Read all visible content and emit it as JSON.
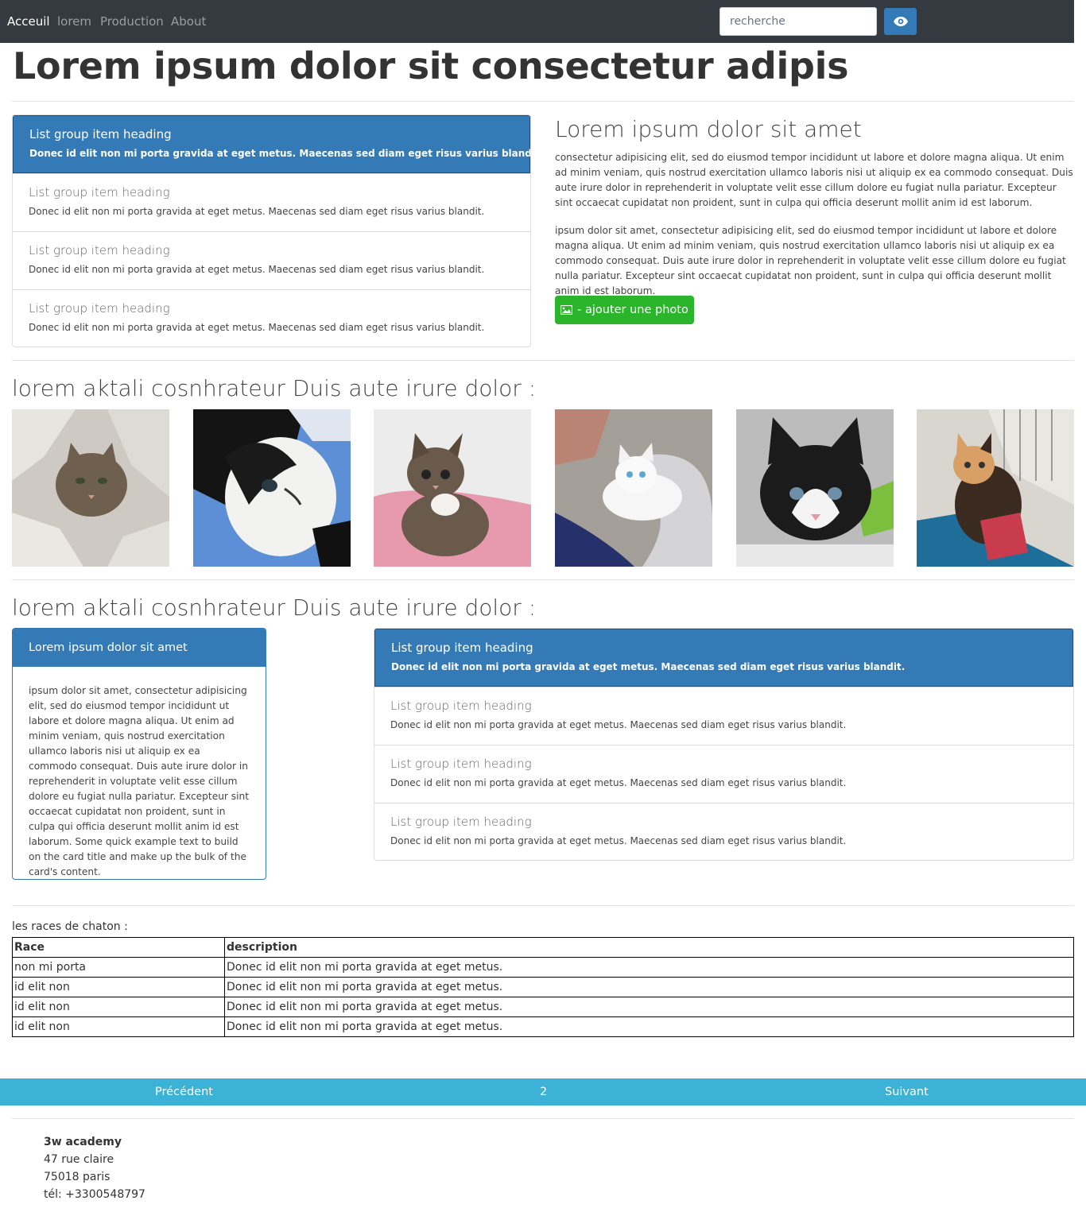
{
  "nav": {
    "links": [
      "Acceuil",
      "lorem",
      "Production",
      "About"
    ],
    "search_placeholder": "recherche",
    "search_button_icon": "eye-icon"
  },
  "main_title": "Lorem ipsum dolor sit consectetur adipis",
  "list_group_1": {
    "items": [
      {
        "heading": "List group item heading",
        "text": "Donec id elit non mi porta gravida at eget metus. Maecenas sed diam eget risus varius blandit.",
        "active": true
      },
      {
        "heading": "List group item heading",
        "text": "Donec id elit non mi porta gravida at eget metus. Maecenas sed diam eget risus varius blandit.",
        "active": false
      },
      {
        "heading": "List group item heading",
        "text": "Donec id elit non mi porta gravida at eget metus. Maecenas sed diam eget risus varius blandit.",
        "active": false
      },
      {
        "heading": "List group item heading",
        "text": "Donec id elit non mi porta gravida at eget metus. Maecenas sed diam eget risus varius blandit.",
        "active": false
      }
    ]
  },
  "intro": {
    "title": "Lorem ipsum dolor sit amet",
    "paragraph_1": "consectetur adipisicing elit, sed do eiusmod tempor incididunt ut labore et dolore magna aliqua. Ut enim ad minim veniam, quis nostrud exercitation ullamco laboris nisi ut aliquip ex ea commodo consequat. Duis aute irure dolor in reprehenderit in voluptate velit esse cillum dolore eu fugiat nulla pariatur. Excepteur sint occaecat cupidatat non proident, sunt in culpa qui officia deserunt mollit anim id est laborum.",
    "paragraph_2": "ipsum dolor sit amet, consectetur adipisicing elit, sed do eiusmod tempor incididunt ut labore et dolore magna aliqua. Ut enim ad minim veniam, quis nostrud exercitation ullamco laboris nisi ut aliquip ex ea commodo consequat. Duis aute irure dolor in reprehenderit in voluptate velit esse cillum dolore eu fugiat nulla pariatur. Excepteur sint occaecat cupidatat non proident, sunt in culpa qui officia deserunt mollit anim id est laborum.",
    "button_label": "- ajouter une photo",
    "button_icon": "image-icon"
  },
  "gallery": {
    "title": "lorem aktali cosnhrateur Duis aute irure dolor :"
  },
  "section_2": {
    "title": "lorem aktali cosnhrateur Duis aute irure dolor :",
    "card": {
      "header": "Lorem ipsum dolor sit amet",
      "body": "ipsum dolor sit amet, consectetur adipisicing elit, sed do eiusmod tempor incididunt ut labore et dolore magna aliqua. Ut enim ad minim veniam, quis nostrud exercitation ullamco laboris nisi ut aliquip ex ea commodo consequat. Duis aute irure dolor in reprehenderit in voluptate velit esse cillum dolore eu fugiat nulla pariatur. Excepteur sint occaecat cupidatat non proident, sunt in culpa qui officia deserunt mollit anim id est laborum. Some quick example text to build on the card title and make up the bulk of the card's content."
    },
    "list_group": {
      "items": [
        {
          "heading": "List group item heading",
          "text": "Donec id elit non mi porta gravida at eget metus. Maecenas sed diam eget risus varius blandit.",
          "active": true
        },
        {
          "heading": "List group item heading",
          "text": "Donec id elit non mi porta gravida at eget metus. Maecenas sed diam eget risus varius blandit.",
          "active": false
        },
        {
          "heading": "List group item heading",
          "text": "Donec id elit non mi porta gravida at eget metus. Maecenas sed diam eget risus varius blandit.",
          "active": false
        },
        {
          "heading": "List group item heading",
          "text": "Donec id elit non mi porta gravida at eget metus. Maecenas sed diam eget risus varius blandit.",
          "active": false
        }
      ]
    }
  },
  "table": {
    "caption": "les races de chaton :",
    "headers": [
      "Race",
      "description"
    ],
    "rows": [
      [
        "non mi porta",
        "Donec id elit non mi porta gravida at eget metus."
      ],
      [
        "id elit non",
        "Donec id elit non mi porta gravida at eget metus."
      ],
      [
        "id elit non",
        "Donec id elit non mi porta gravida at eget metus."
      ],
      [
        "id elit non",
        "Donec id elit non mi porta gravida at eget metus."
      ]
    ]
  },
  "pagination": {
    "prev": "Précédent",
    "page": "2",
    "next": "Suivant"
  },
  "footer": {
    "name": "3w academy",
    "address": "47 rue claire",
    "city": "75018 paris",
    "phone": "tél: +3300548797"
  },
  "colors": {
    "navbar": "#343a40",
    "primary": "#337ab7",
    "success": "#2bb52b",
    "info": "#3bb2d6"
  }
}
